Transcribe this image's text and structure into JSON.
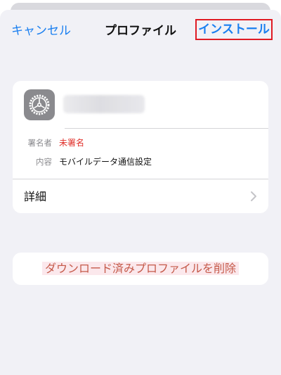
{
  "nav": {
    "cancel_label": "キャンセル",
    "title": "プロファイル",
    "install_label": "インストール"
  },
  "profile": {
    "icon": "settings-gear-icon",
    "name_redacted": true,
    "signer_label": "署名者",
    "signer_value": "未署名",
    "content_label": "内容",
    "content_value": "モバイルデータ通信設定",
    "details_label": "詳細"
  },
  "actions": {
    "delete_label": "ダウンロード済みプロファイルを削除"
  },
  "colors": {
    "accent": "#1a7ff0",
    "highlight_border": "#e01b24",
    "unsigned_text": "#e0302a",
    "delete_text": "#c55a4a",
    "background": "#f1f1f6"
  }
}
